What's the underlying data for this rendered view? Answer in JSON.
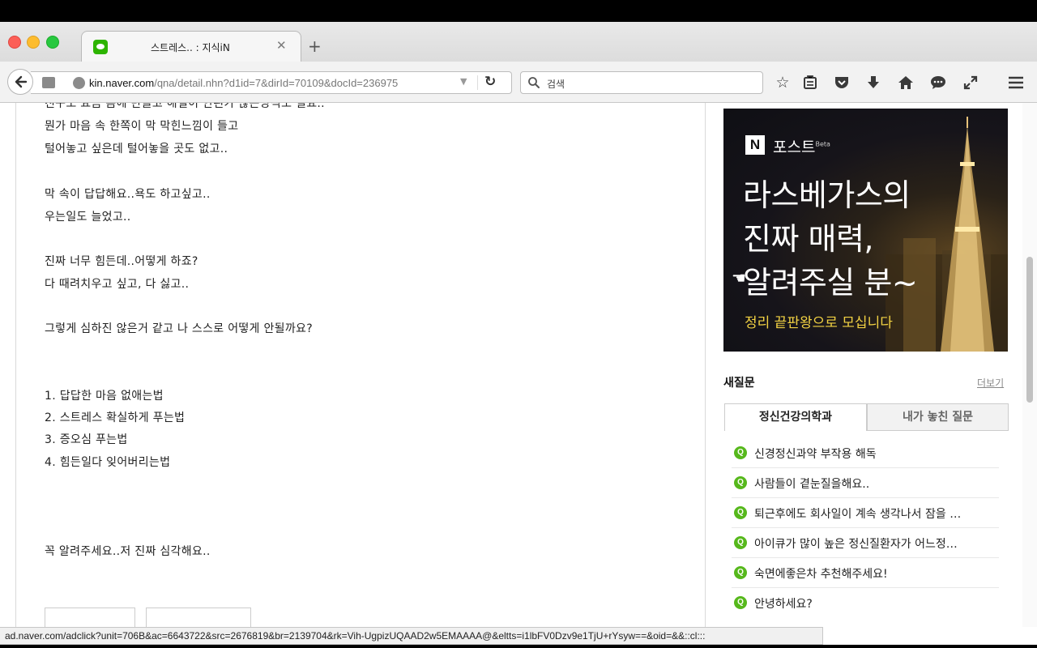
{
  "browser": {
    "tab": {
      "title": "스트레스.. : 지식iN"
    },
    "address_host": "kin.naver.com",
    "address_path": "/qna/detail.nhn?d1id=7&dirId=70109&docId=236975",
    "search_placeholder": "검색",
    "status_url": "ad.naver.com/adclick?unit=706B&ac=6643722&src=2676819&br=2139704&rk=Vih-UgpizUQAAD2w5EMAAAA@&eltts=i1lbFV0Dzv9e1TjU+rYsyw==&oid=&&::cl:::"
  },
  "toolbar_icons": [
    "star-icon",
    "reading-list-icon",
    "pocket-icon",
    "download-icon",
    "home-icon",
    "chat-icon",
    "fullscreen-icon",
    "menu-icon"
  ],
  "post": {
    "lines": [
      "친구도 요즘 음에 만들고 해결이 안된가 끊는방식도 필요..",
      "뭔가 마음 속 한쪽이 막 막힌느낌이 들고",
      "털어놓고 싶은데 털어놓을 곳도 없고..",
      "막 속이 답답해요..욕도 하고싶고..",
      "우는일도 늘었고..",
      "진짜 너무 힘든데..어떻게 하죠?",
      "다 때려치우고 싶고, 다 싫고..",
      "그렇게 심하진 않은거 같고 나 스스로 어떻게 안될까요?",
      "1. 답답한 마음 없애는법",
      "2. 스트레스 확실하게 푸는법",
      "3. 증오심 푸는법",
      "4. 힘든일다 잊어버리는법",
      "꼭 알려주세요..저 진짜 심각해요.."
    ]
  },
  "ad": {
    "logo": "N",
    "brand": "포스트",
    "brand_sup": "Beta",
    "headline_1": "라스베가스의",
    "headline_2": "진짜 매력,",
    "headline_3": "알려주실 분~",
    "sub": "정리 끝판왕으로 모십니다"
  },
  "new_questions": {
    "title": "새질문",
    "more": "더보기",
    "tabs": [
      "정신건강의학과",
      "내가 놓친 질문"
    ],
    "badge": "Q",
    "items": [
      "신경정신과약 부작용 해독",
      "사람들이 곁눈질을해요..",
      "퇴근후에도 회사일이 계속 생각나서 잠을 …",
      "아이큐가 많이 높은 정신질환자가 어느정…",
      "숙면에좋은차 추천해주세요!",
      "안녕하세요?"
    ]
  }
}
